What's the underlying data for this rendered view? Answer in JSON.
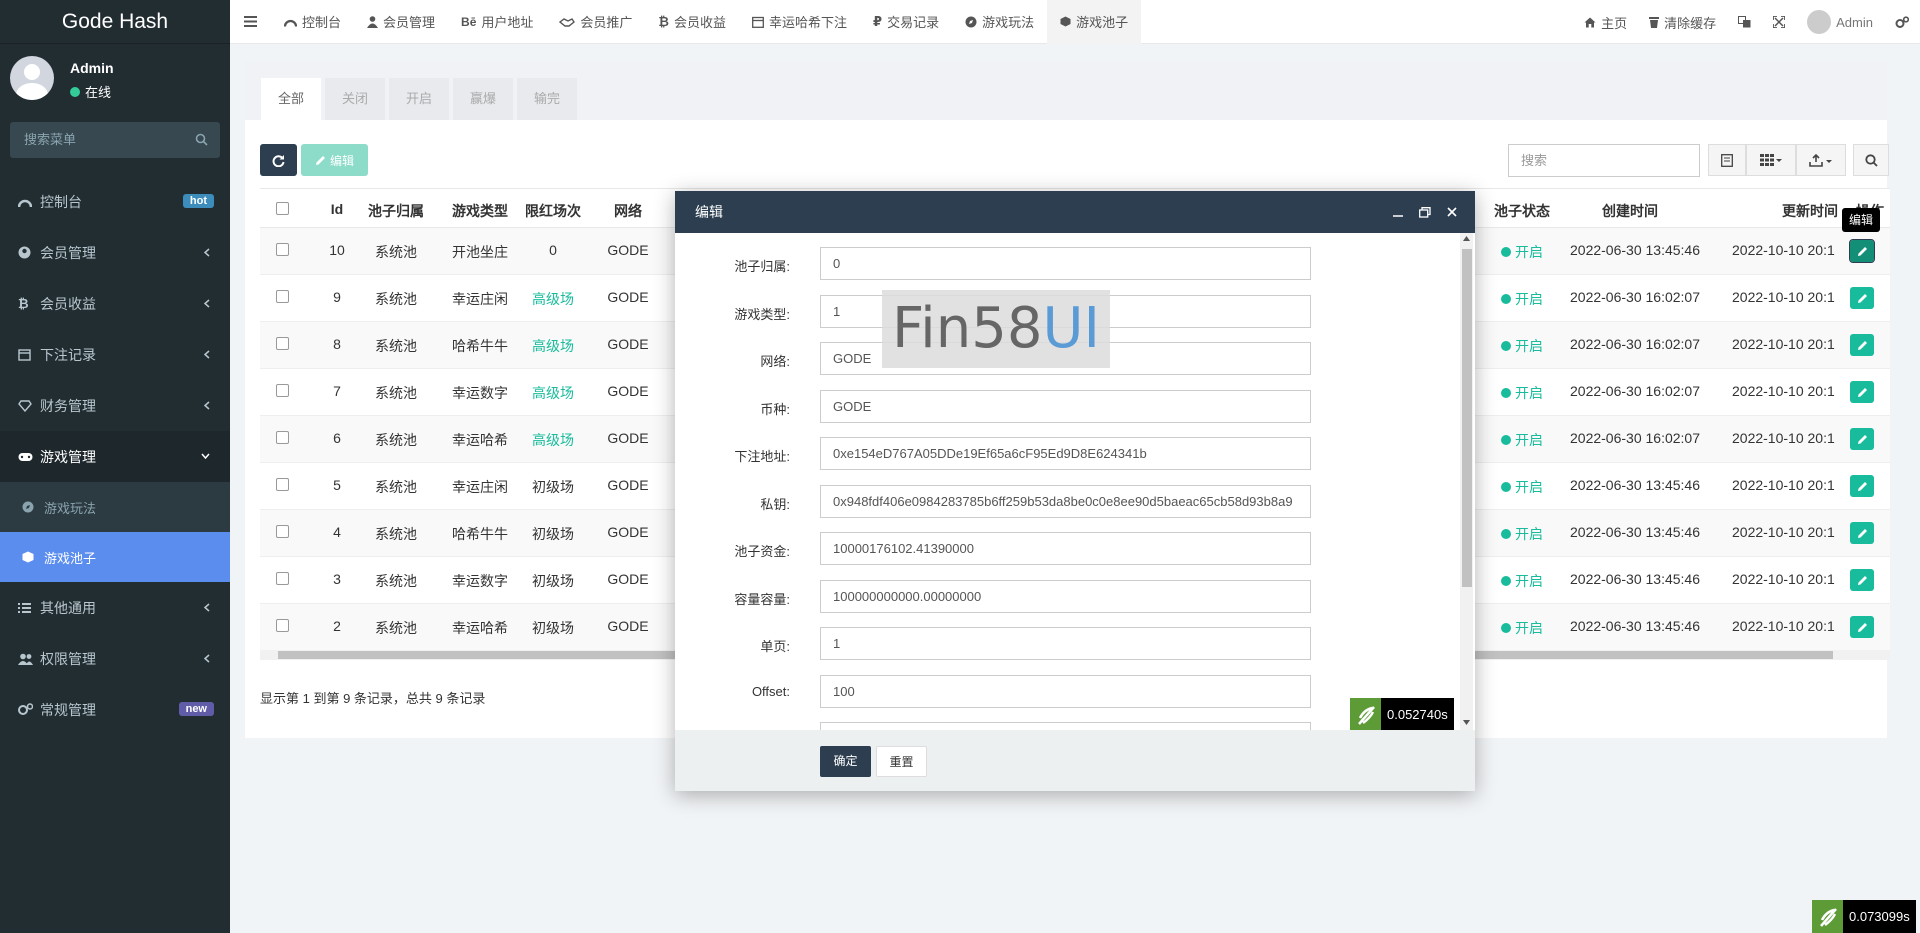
{
  "app": {
    "title": "Gode Hash"
  },
  "user": {
    "name": "Admin",
    "status": "在线"
  },
  "sidebar": {
    "search_placeholder": "搜索菜单",
    "items": [
      {
        "label": "控制台",
        "badge": "hot"
      },
      {
        "label": "会员管理"
      },
      {
        "label": "会员收益"
      },
      {
        "label": "下注记录"
      },
      {
        "label": "财务管理"
      },
      {
        "label": "游戏管理"
      },
      {
        "label": "其他通用"
      },
      {
        "label": "权限管理"
      },
      {
        "label": "常规管理",
        "badge": "new"
      }
    ],
    "sub_items": [
      {
        "label": "游戏玩法"
      },
      {
        "label": "游戏池子"
      }
    ]
  },
  "topnav": {
    "items": [
      "控制台",
      "会员管理",
      "用户地址",
      "会员推广",
      "会员收益",
      "幸运哈希下注",
      "交易记录",
      "游戏玩法",
      "游戏池子"
    ],
    "home": "主页",
    "clear_cache": "清除缓存",
    "admin": "Admin"
  },
  "tabs": [
    "全部",
    "关闭",
    "开启",
    "赢爆",
    "输完"
  ],
  "toolbar": {
    "edit_label": "编辑",
    "search_placeholder": "搜索",
    "tooltip": "编辑"
  },
  "table": {
    "headers": [
      "Id",
      "池子归属",
      "游戏类型",
      "限红场次",
      "网络",
      "池子状态",
      "创建时间",
      "更新时间",
      "操作"
    ],
    "rows": [
      {
        "id": "10",
        "owner": "系统池",
        "type": "开池坐庄",
        "level": "0",
        "net": "GODE",
        "status": "开启",
        "created": "2022-06-30 13:45:46",
        "updated": "2022-10-10 20:1"
      },
      {
        "id": "9",
        "owner": "系统池",
        "type": "幸运庄闲",
        "level": "高级场",
        "net": "GODE",
        "status": "开启",
        "created": "2022-06-30 16:02:07",
        "updated": "2022-10-10 20:1"
      },
      {
        "id": "8",
        "owner": "系统池",
        "type": "哈希牛牛",
        "level": "高级场",
        "net": "GODE",
        "status": "开启",
        "created": "2022-06-30 16:02:07",
        "updated": "2022-10-10 20:1"
      },
      {
        "id": "7",
        "owner": "系统池",
        "type": "幸运数字",
        "level": "高级场",
        "net": "GODE",
        "status": "开启",
        "created": "2022-06-30 16:02:07",
        "updated": "2022-10-10 20:1"
      },
      {
        "id": "6",
        "owner": "系统池",
        "type": "幸运哈希",
        "level": "高级场",
        "net": "GODE",
        "status": "开启",
        "created": "2022-06-30 16:02:07",
        "updated": "2022-10-10 20:1"
      },
      {
        "id": "5",
        "owner": "系统池",
        "type": "幸运庄闲",
        "level": "初级场",
        "net": "GODE",
        "status": "开启",
        "created": "2022-06-30 13:45:46",
        "updated": "2022-10-10 20:1"
      },
      {
        "id": "4",
        "owner": "系统池",
        "type": "哈希牛牛",
        "level": "初级场",
        "net": "GODE",
        "status": "开启",
        "created": "2022-06-30 13:45:46",
        "updated": "2022-10-10 20:1"
      },
      {
        "id": "3",
        "owner": "系统池",
        "type": "幸运数字",
        "level": "初级场",
        "net": "GODE",
        "status": "开启",
        "created": "2022-06-30 13:45:46",
        "updated": "2022-10-10 20:1"
      },
      {
        "id": "2",
        "owner": "系统池",
        "type": "幸运哈希",
        "level": "初级场",
        "net": "GODE",
        "status": "开启",
        "created": "2022-06-30 13:45:46",
        "updated": "2022-10-10 20:1"
      }
    ],
    "footer": "显示第 1 到第 9 条记录，总共 9 条记录"
  },
  "modal": {
    "title": "编辑",
    "fields": [
      {
        "label": "池子归属:",
        "value": "0"
      },
      {
        "label": "游戏类型:",
        "value": "1"
      },
      {
        "label": "网络:",
        "value": "GODE"
      },
      {
        "label": "币种:",
        "value": "GODE"
      },
      {
        "label": "下注地址:",
        "value": "0xe154eD767A05DDe19Ef65a6cF95Ed9D8E624341b"
      },
      {
        "label": "私钥:",
        "value": "0x948fdf406e0984283785b6ff259b53da8be0c0e8ee90d5baeac65cb58d93b8a9"
      },
      {
        "label": "池子资金:",
        "value": "10000176102.41390000"
      },
      {
        "label": "容量容量:",
        "value": "100000000000.00000000"
      },
      {
        "label": "单页:",
        "value": "1"
      },
      {
        "label": "Offset:",
        "value": "100"
      }
    ],
    "confirm": "确定",
    "reset": "重置",
    "timer": "0.052740s"
  },
  "watermark": "Fin58UI",
  "page_timer": "0.073099s"
}
